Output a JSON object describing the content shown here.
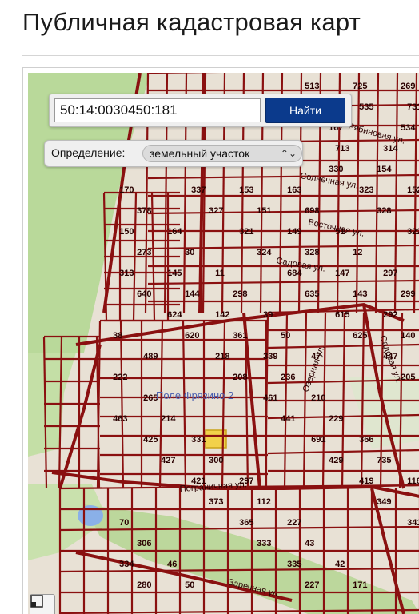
{
  "page": {
    "title": "Публичная кадастровая карт"
  },
  "search": {
    "value": "50:14:0030450:181",
    "button_label": "Найти"
  },
  "definition": {
    "label": "Определение:",
    "selected": "земельный участок"
  },
  "map": {
    "colors": {
      "background": "#e8e1d5",
      "parcel_line": "#8a1010",
      "forest": "#b9d99a",
      "water": "#8ab0e8",
      "selected_parcel": "#f2d14a"
    },
    "district_label": "Поле Фрязино 2",
    "street_labels": [
      "Пограничная ул.",
      "Заречная ул.",
      "Солнечная ул.",
      "Восточная ул.",
      "Садовая ул.",
      "Озерная ул.",
      "Садовая ул.",
      "Рябиновая ул."
    ],
    "parcel_numbers": [
      "513",
      "535",
      "534",
      "330",
      "337",
      "323",
      "327",
      "328",
      "321",
      "322",
      "324",
      "313",
      "684",
      "640",
      "635",
      "624",
      "615",
      "620",
      "625",
      "218",
      "447",
      "208",
      "205",
      "461",
      "463",
      "441",
      "425",
      "691",
      "427",
      "429",
      "421",
      "419",
      "373",
      "349",
      "365",
      "341",
      "333",
      "334",
      "335",
      "280",
      "227",
      "725",
      "731",
      "713",
      "154",
      "153",
      "152",
      "151",
      "150",
      "149",
      "273",
      "328",
      "145",
      "147",
      "144",
      "143",
      "142",
      "292",
      "361",
      "140",
      "339",
      "222",
      "236",
      "265",
      "210",
      "214",
      "229",
      "331",
      "366",
      "300",
      "735",
      "297",
      "116",
      "112",
      "70",
      "227",
      "306",
      "43",
      "46",
      "42",
      "50",
      "171",
      "269",
      "167",
      "314",
      "170",
      "163",
      "378",
      "698",
      "164",
      "51",
      "30",
      "12",
      "11",
      "297",
      "298",
      "299",
      "39",
      "38",
      "50",
      "489",
      "47"
    ]
  },
  "controls": {
    "layers_icon": "layers-icon"
  }
}
